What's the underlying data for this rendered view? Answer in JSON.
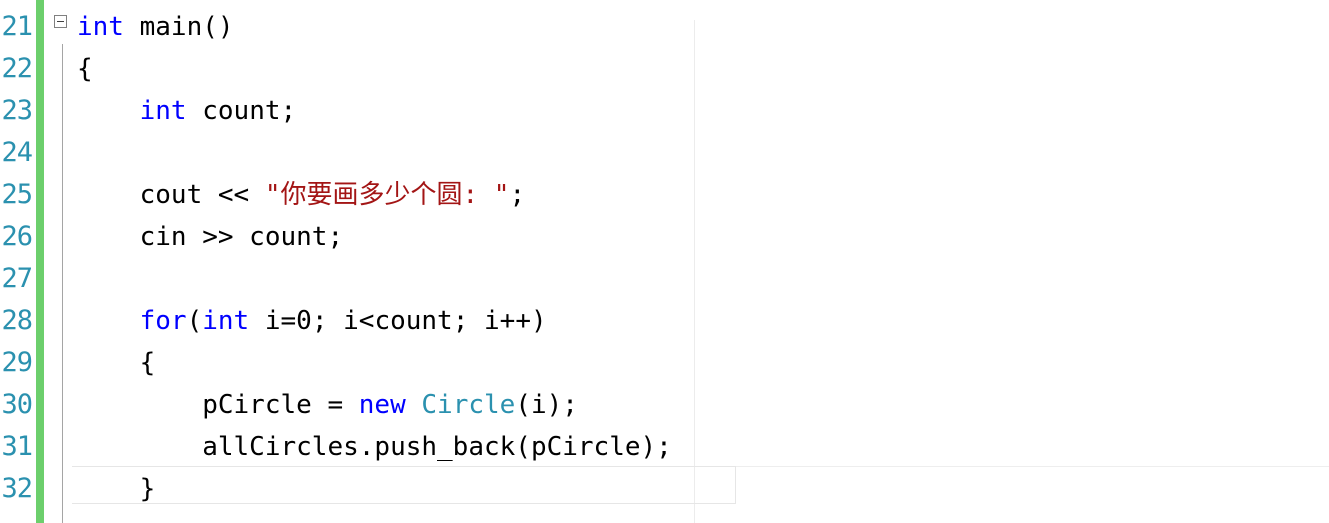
{
  "colors": {
    "line_number": "#2b91af",
    "change_bar": "#6ccf6c",
    "keyword": "#0000ff",
    "string": "#a31515",
    "type": "#2b91af",
    "text": "#000000"
  },
  "icons": {
    "fold": "collapse-minus-icon"
  },
  "lines": [
    {
      "number": "21",
      "segments": [
        {
          "t": "int",
          "c": "kw"
        },
        {
          "t": " main()",
          "c": ""
        }
      ]
    },
    {
      "number": "22",
      "segments": [
        {
          "t": "{",
          "c": ""
        }
      ]
    },
    {
      "number": "23",
      "segments": [
        {
          "t": "    ",
          "c": ""
        },
        {
          "t": "int",
          "c": "kw"
        },
        {
          "t": " count;",
          "c": ""
        }
      ]
    },
    {
      "number": "24",
      "segments": []
    },
    {
      "number": "25",
      "segments": [
        {
          "t": "    cout << ",
          "c": ""
        },
        {
          "t": "\"你要画多少个圆: \"",
          "c": "str"
        },
        {
          "t": ";",
          "c": ""
        }
      ]
    },
    {
      "number": "26",
      "segments": [
        {
          "t": "    cin >> count;",
          "c": ""
        }
      ]
    },
    {
      "number": "27",
      "segments": []
    },
    {
      "number": "28",
      "segments": [
        {
          "t": "    ",
          "c": ""
        },
        {
          "t": "for",
          "c": "kw"
        },
        {
          "t": "(",
          "c": ""
        },
        {
          "t": "int",
          "c": "kw"
        },
        {
          "t": " i=0; i<count; i++)",
          "c": ""
        }
      ]
    },
    {
      "number": "29",
      "segments": [
        {
          "t": "    {",
          "c": ""
        }
      ]
    },
    {
      "number": "30",
      "segments": [
        {
          "t": "        pCircle = ",
          "c": ""
        },
        {
          "t": "new",
          "c": "kw"
        },
        {
          "t": " ",
          "c": ""
        },
        {
          "t": "Circle",
          "c": "cls"
        },
        {
          "t": "(i);",
          "c": ""
        }
      ]
    },
    {
      "number": "31",
      "segments": [
        {
          "t": "        allCircles.push_back(pCircle);",
          "c": ""
        }
      ]
    },
    {
      "number": "32",
      "segments": [
        {
          "t": "    }",
          "c": ""
        }
      ]
    }
  ]
}
